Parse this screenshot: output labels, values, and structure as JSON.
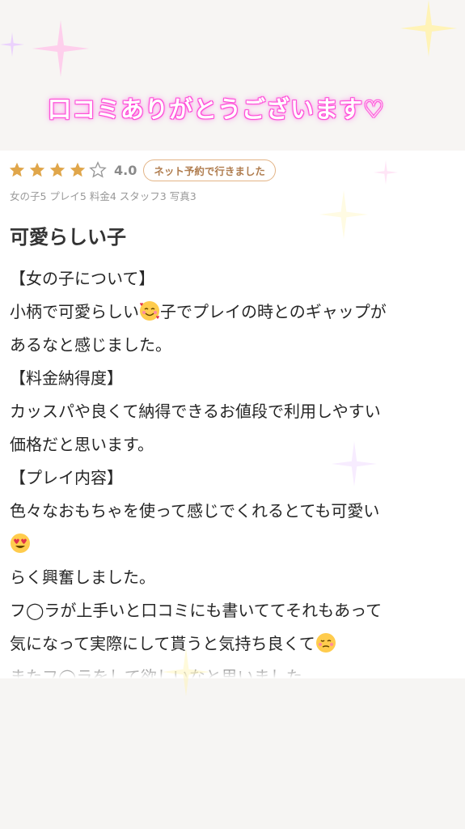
{
  "banner": {
    "text": "口コミありがとうございます♡"
  },
  "review": {
    "stars_filled": 4,
    "stars_total": 5,
    "score": "4.0",
    "badge": "ネット予約で行きました",
    "sub_scores": "女の子5 プレイ5 料金4 スタッフ3 写真3",
    "title": "可愛らしい子",
    "lines": [
      {
        "text": "【女の子について】"
      },
      {
        "before": "小柄で可愛らしい",
        "emoji": "smiling-face-with-hearts-emoji",
        "after": "子でプレイの時とのギャップが"
      },
      {
        "text": "あるなと感じました。"
      },
      {
        "text": "【料金納得度】"
      },
      {
        "text": "カッスパや良くて納得できるお値段で利用しやすい"
      },
      {
        "text": "価格だと思います。"
      },
      {
        "text": "【プレイ内容】"
      },
      {
        "text": "色々なおもちゃを使って感じでくれるとても可愛い"
      },
      {
        "emoji_only": "heart-eyes-emoji"
      },
      {
        "text": "らく興奮しました。"
      },
      {
        "text": "フ◯ラが上手いと口コミにも書いててそれもあって"
      },
      {
        "before": "気になって実際にして貰うと気持ち良くて",
        "emoji": "woozy-face-emoji",
        "after": ""
      },
      {
        "text": "またフ◯ラをして欲しいなと思いました。"
      }
    ]
  },
  "colors": {
    "star_gold": "#e0a64a",
    "banner_glow": "#ff4fd8",
    "badge_border": "#e3b486"
  }
}
